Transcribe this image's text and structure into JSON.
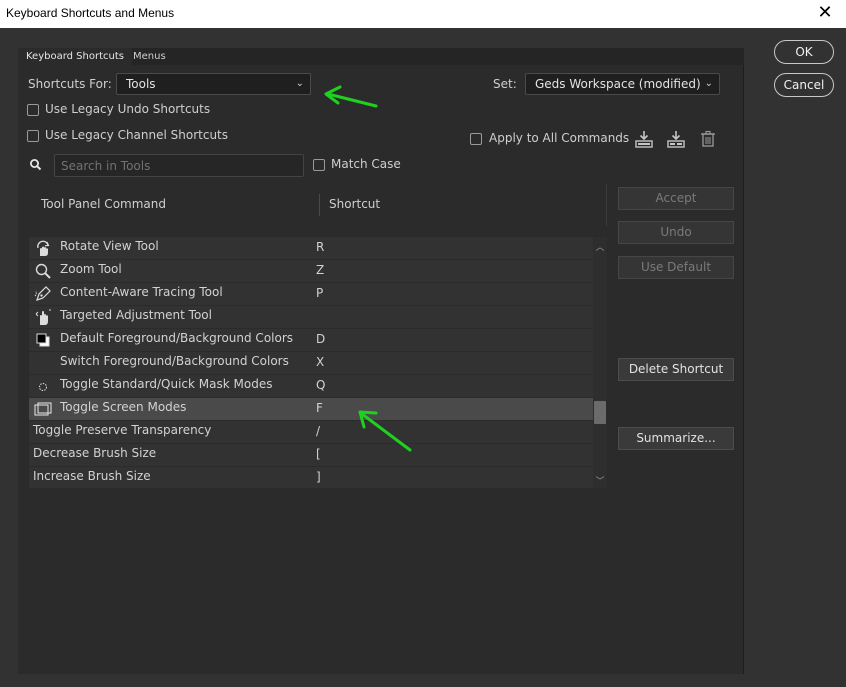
{
  "window": {
    "title": "Keyboard Shortcuts and Menus",
    "close_glyph": "✕"
  },
  "tabs": [
    {
      "label": "Keyboard Shortcuts"
    },
    {
      "label": "Menus"
    }
  ],
  "shortcuts_for": {
    "label": "Shortcuts For:",
    "value": "Tools"
  },
  "set": {
    "label": "Set:",
    "value": "Geds Workspace (modified)"
  },
  "legacy_undo": {
    "label": "Use Legacy Undo Shortcuts",
    "checked": false
  },
  "legacy_channel": {
    "label": "Use Legacy Channel Shortcuts",
    "checked": false
  },
  "apply_all": {
    "label": "Apply to All Commands",
    "checked": false
  },
  "search": {
    "placeholder": "Search in Tools",
    "value": ""
  },
  "match_case": {
    "label": "Match Case",
    "checked": false
  },
  "table": {
    "col_command": "Tool Panel Command",
    "col_shortcut": "Shortcut",
    "rows": [
      {
        "name": "Rotate View Tool",
        "key": "R",
        "icon": "rotate-view-icon"
      },
      {
        "name": "Zoom Tool",
        "key": "Z",
        "icon": "zoom-icon"
      },
      {
        "name": "Content-Aware Tracing Tool",
        "key": "P",
        "icon": "pen-tracing-icon"
      },
      {
        "name": "Targeted Adjustment Tool",
        "key": "",
        "icon": "hand-adjust-icon"
      },
      {
        "name": "Default Foreground/Background Colors",
        "key": "D",
        "icon": "default-colors-icon"
      },
      {
        "name": "Switch Foreground/Background Colors",
        "key": "X",
        "icon": ""
      },
      {
        "name": "Toggle Standard/Quick Mask Modes",
        "key": "Q",
        "icon": "quick-mask-icon"
      },
      {
        "name": "Toggle Screen Modes",
        "key": "F",
        "icon": "screen-mode-icon",
        "selected": true
      },
      {
        "name": "Toggle Preserve Transparency",
        "key": "/",
        "icon": ""
      },
      {
        "name": "Decrease Brush Size",
        "key": "[",
        "icon": ""
      },
      {
        "name": "Increase Brush Size",
        "key": "]",
        "icon": ""
      }
    ]
  },
  "actions": {
    "accept": "Accept",
    "undo": "Undo",
    "use_default": "Use Default",
    "delete_shortcut": "Delete Shortcut",
    "summarize": "Summarize..."
  },
  "dialog": {
    "ok": "OK",
    "cancel": "Cancel"
  },
  "colors": {
    "annotation_arrow": "#1fd11f",
    "selected_row": "#4a4a4a"
  }
}
